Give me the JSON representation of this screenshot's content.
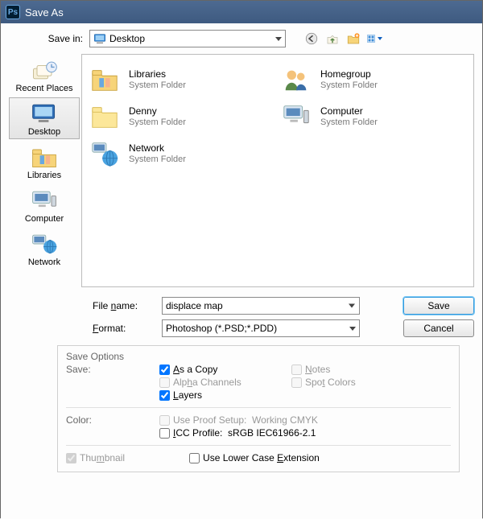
{
  "title": "Save As",
  "savein_label": "Save in:",
  "savein_value": "Desktop",
  "toolbar": {
    "back": "back",
    "up": "up",
    "newfolder": "new-folder",
    "view": "view-menu"
  },
  "places": [
    {
      "key": "recent",
      "label": "Recent Places",
      "selected": false
    },
    {
      "key": "desktop",
      "label": "Desktop",
      "selected": true
    },
    {
      "key": "libraries",
      "label": "Libraries",
      "selected": false
    },
    {
      "key": "computer",
      "label": "Computer",
      "selected": false
    },
    {
      "key": "network",
      "label": "Network",
      "selected": false
    }
  ],
  "items": [
    {
      "name": "Libraries",
      "sub": "System Folder",
      "icon": "libraries"
    },
    {
      "name": "Homegroup",
      "sub": "System Folder",
      "icon": "people"
    },
    {
      "name": "Denny",
      "sub": "System Folder",
      "icon": "userfolder"
    },
    {
      "name": "Computer",
      "sub": "System Folder",
      "icon": "monitor"
    },
    {
      "name": "Network",
      "sub": "System Folder",
      "icon": "network"
    }
  ],
  "file_name_label": "File name:",
  "file_name_value": "displace map",
  "format_label": "Format:",
  "format_value": "Photoshop (*.PSD;*.PDD)",
  "save_btn": "Save",
  "cancel_btn": "Cancel",
  "save_options_label": "Save Options",
  "save_label2": "Save:",
  "copy_label": "As a Copy",
  "notes_label": "Notes",
  "alpha_label": "Alpha Channels",
  "spot_label": "Spot Colors",
  "layers_label": "Layers",
  "color_label": "Color:",
  "proof_label": "Use Proof Setup:  Working CMYK",
  "icc_label": "ICC Profile:  sRGB IEC61966-2.1",
  "thumb_label": "Thumbnail",
  "lower_label": "Use Lower Case Extension"
}
